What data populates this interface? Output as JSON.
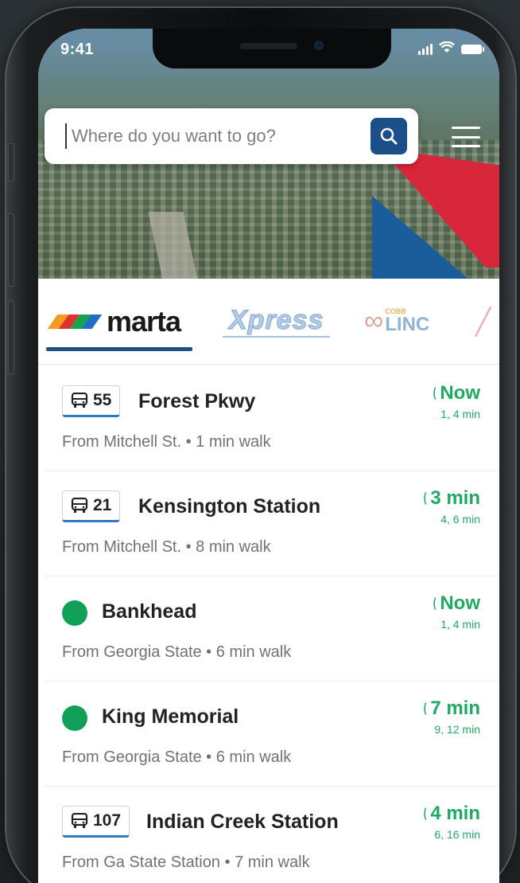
{
  "status_bar": {
    "time": "9:41"
  },
  "search": {
    "placeholder": "Where do you want to go?"
  },
  "agencies": {
    "marta": {
      "label": "marta",
      "colors": [
        "#f39b1f",
        "#e0312f",
        "#16a34a",
        "#1e6fc4"
      ],
      "selected": true
    },
    "xpress": {
      "label": "Xpress"
    },
    "cobblinc": {
      "small": "COBB",
      "big": "LINC"
    }
  },
  "departures": [
    {
      "kind": "bus",
      "route": "55",
      "destination": "Forest Pkwy",
      "from": "From Mitchell St. • 1 min walk",
      "eta": "Now",
      "next": "1, 4 min"
    },
    {
      "kind": "bus",
      "route": "21",
      "destination": "Kensington Station",
      "from": "From Mitchell St. • 8 min walk",
      "eta": "3 min",
      "next": "4, 6 min"
    },
    {
      "kind": "rail",
      "line_color": "#11a058",
      "destination": "Bankhead",
      "from": "From Georgia State • 6 min walk",
      "eta": "Now",
      "next": "1, 4 min"
    },
    {
      "kind": "rail",
      "line_color": "#11a058",
      "destination": "King Memorial",
      "from": "From Georgia State • 6 min walk",
      "eta": "7 min",
      "next": "9, 12 min"
    },
    {
      "kind": "bus",
      "route": "107",
      "destination": "Indian Creek Station",
      "from": "From Ga State Station • 7 min walk",
      "eta": "4 min",
      "next": "6, 16 min"
    }
  ],
  "colors": {
    "eta_green": "#1faa62",
    "marta_blue": "#1f4f7e",
    "search_button": "#1c4f8a"
  }
}
